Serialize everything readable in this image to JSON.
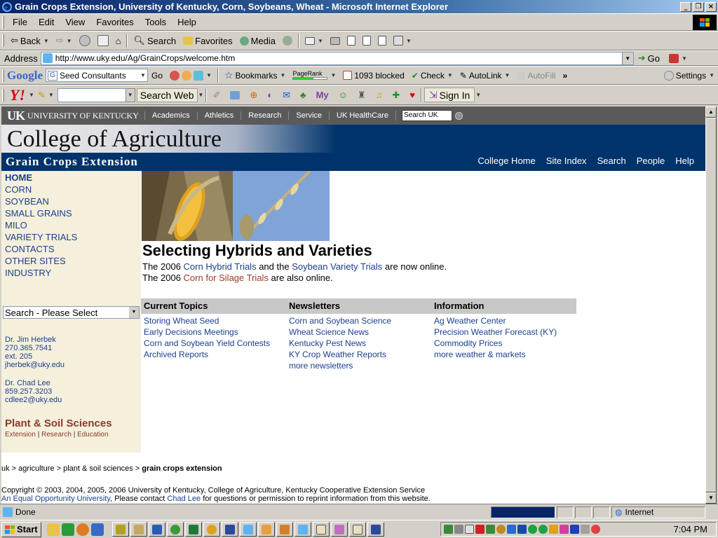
{
  "window": {
    "title": "Grain Crops Extension, University of Kentucky, Corn, Soybeans, Wheat - Microsoft Internet Explorer",
    "minimize": "_",
    "maximize": "❐",
    "close": "×"
  },
  "menu": [
    "File",
    "Edit",
    "View",
    "Favorites",
    "Tools",
    "Help"
  ],
  "toolbar": {
    "back": "Back",
    "search": "Search",
    "favorites": "Favorites",
    "media": "Media"
  },
  "address": {
    "label": "Address",
    "url": "http://www.uky.edu/Ag/GrainCrops/welcome.htm",
    "go": "Go"
  },
  "google_bar": {
    "logo": "Google",
    "search_value": "Seed Consultants",
    "go": "Go",
    "bookmarks": "Bookmarks",
    "pagerank": "PageRank",
    "blocked": "1093 blocked",
    "check": "Check",
    "autolink": "AutoLink",
    "autofill": "AutoFill",
    "more": "»",
    "settings": "Settings"
  },
  "yahoo_bar": {
    "logo": "Y!",
    "search_web": "Search Web",
    "sign_in": "Sign In"
  },
  "uk_bar": {
    "logo": "UK",
    "name": "UNIVERSITY OF KENTUCKY",
    "nav": [
      "Academics",
      "Athletics",
      "Research",
      "Service",
      "UK HealthCare"
    ],
    "search_placeholder": "Search UK"
  },
  "banner": {
    "college": "College of Agriculture",
    "subtitle": "Grain Crops Extension",
    "topnav": [
      "College Home",
      "Site Index",
      "Search",
      "People",
      "Help"
    ]
  },
  "sidebar": {
    "nav": [
      "HOME",
      "CORN",
      "SOYBEAN",
      "SMALL GRAINS",
      "MILO",
      "VARIETY TRIALS",
      "CONTACTS",
      "OTHER SITES",
      "INDUSTRY"
    ],
    "select_value": "Search - Please Select",
    "contact1": [
      "Dr. Jim Herbek",
      "270.365.7541",
      "ext. 205",
      "jherbek@uky.edu"
    ],
    "contact2": [
      "Dr. Chad Lee",
      "859.257.3203",
      "cdlee2@uky.edu"
    ],
    "dept": "Plant & Soil Sciences",
    "dept_links": [
      "Extension",
      "Research",
      "Education"
    ],
    "dept_sep": "|"
  },
  "main": {
    "title": "Selecting Hybrids and Varieties",
    "line1": {
      "pre": "The 2006 ",
      "link1": "Corn Hybrid Trials",
      "mid": " and the ",
      "link2": "Soybean Variety Trials",
      "post": " are now online."
    },
    "line2": {
      "pre": "The 2006 ",
      "link": "Corn for Silage Trials",
      "post": " are also online."
    },
    "columns": [
      {
        "header": "Current Topics",
        "links": [
          "Storing Wheat Seed",
          "Early Decisions Meetings",
          "Corn and Soybean Yield Contests",
          "Archived Reports"
        ]
      },
      {
        "header": "Newsletters",
        "links": [
          "Corn and Soybean Science",
          "Wheat Science News",
          "Kentucky Pest News",
          "KY Crop Weather Reports",
          "more newsletters"
        ]
      },
      {
        "header": "Information",
        "links": [
          "Ag Weather Center",
          "Precision Weather Forecast (KY)",
          "Commodity Prices",
          "more weather & markets"
        ]
      }
    ]
  },
  "footer": {
    "crumb": [
      "uk",
      "agriculture",
      "plant & soil sciences"
    ],
    "crumb_current": "grain crops extension",
    "crumb_sep": " > ",
    "copyright": "Copyright © 2003, 2004, 2005, 2006 University of Kentucky, College of Agriculture, Kentucky Cooperative Extension Service",
    "eo_link": "An Equal Opportunity University",
    "eo_mid": ", Please contact ",
    "contact_link": "Chad Lee",
    "eo_post": " for questions or permission to reprint information from this website."
  },
  "status": {
    "text": "Done",
    "zone": "Internet"
  },
  "taskbar": {
    "start": "Start",
    "clock": "7:04 PM"
  },
  "colors": {
    "uk_blue": "#00336b",
    "link_blue": "#1a3f8f",
    "accent_red": "#9c3a2a",
    "sidebar_bg": "#f5f0dc"
  }
}
